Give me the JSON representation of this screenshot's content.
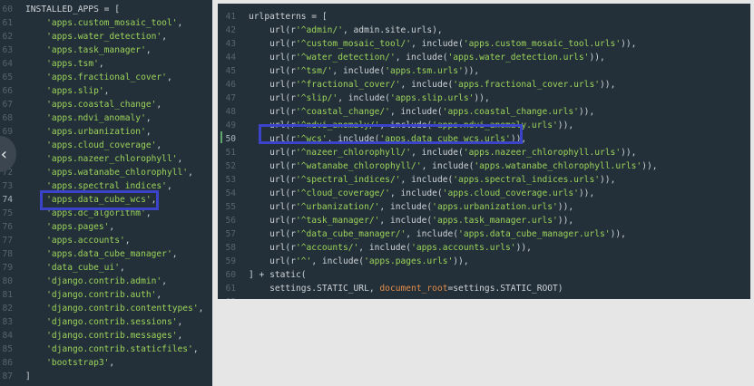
{
  "left_editor": {
    "lines": [
      {
        "n": "60",
        "parts": [
          [
            "src",
            "INSTALLED_APPS = ["
          ]
        ]
      },
      {
        "n": "61",
        "parts": [
          [
            "src",
            "    "
          ],
          [
            "str",
            "'apps.custom_mosaic_tool'"
          ],
          [
            "src",
            ","
          ]
        ]
      },
      {
        "n": "62",
        "parts": [
          [
            "src",
            "    "
          ],
          [
            "str",
            "'apps.water_detection'"
          ],
          [
            "src",
            ","
          ]
        ]
      },
      {
        "n": "63",
        "parts": [
          [
            "src",
            "    "
          ],
          [
            "str",
            "'apps.task_manager'"
          ],
          [
            "src",
            ","
          ]
        ]
      },
      {
        "n": "64",
        "parts": [
          [
            "src",
            "    "
          ],
          [
            "str",
            "'apps.tsm'"
          ],
          [
            "src",
            ","
          ]
        ]
      },
      {
        "n": "65",
        "parts": [
          [
            "src",
            "    "
          ],
          [
            "str",
            "'apps.fractional_cover'"
          ],
          [
            "src",
            ","
          ]
        ]
      },
      {
        "n": "66",
        "parts": [
          [
            "src",
            "    "
          ],
          [
            "str",
            "'apps.slip'"
          ],
          [
            "src",
            ","
          ]
        ]
      },
      {
        "n": "67",
        "parts": [
          [
            "src",
            "    "
          ],
          [
            "str",
            "'apps.coastal_change'"
          ],
          [
            "src",
            ","
          ]
        ]
      },
      {
        "n": "68",
        "parts": [
          [
            "src",
            "    "
          ],
          [
            "str",
            "'apps.ndvi_anomaly'"
          ],
          [
            "src",
            ","
          ]
        ]
      },
      {
        "n": "69",
        "parts": [
          [
            "src",
            "    "
          ],
          [
            "str",
            "'apps.urbanization'"
          ],
          [
            "src",
            ","
          ]
        ]
      },
      {
        "n": "70",
        "parts": [
          [
            "src",
            "    "
          ],
          [
            "str",
            "'apps.cloud_coverage'"
          ],
          [
            "src",
            ","
          ]
        ]
      },
      {
        "n": "71",
        "parts": [
          [
            "src",
            "    "
          ],
          [
            "str",
            "'apps.nazeer_chlorophyll'"
          ],
          [
            "src",
            ","
          ]
        ]
      },
      {
        "n": "72",
        "parts": [
          [
            "src",
            "    "
          ],
          [
            "str",
            "'apps.watanabe_chlorophyll'"
          ],
          [
            "src",
            ","
          ]
        ]
      },
      {
        "n": "73",
        "parts": [
          [
            "src",
            "    "
          ],
          [
            "str",
            "'apps.spectral_indices'"
          ],
          [
            "src",
            ","
          ]
        ]
      },
      {
        "n": "74",
        "parts": [
          [
            "src",
            "    "
          ],
          [
            "str",
            "'apps.data_cube_wcs'"
          ],
          [
            "src",
            ","
          ]
        ],
        "active": true
      },
      {
        "n": "75",
        "parts": [
          [
            "src",
            "    "
          ],
          [
            "str",
            "'apps.dc_algorithm'"
          ],
          [
            "src",
            ","
          ]
        ]
      },
      {
        "n": "76",
        "parts": [
          [
            "src",
            "    "
          ],
          [
            "str",
            "'apps.pages'"
          ],
          [
            "src",
            ","
          ]
        ]
      },
      {
        "n": "77",
        "parts": [
          [
            "src",
            "    "
          ],
          [
            "str",
            "'apps.accounts'"
          ],
          [
            "src",
            ","
          ]
        ]
      },
      {
        "n": "78",
        "parts": [
          [
            "src",
            "    "
          ],
          [
            "str",
            "'apps.data_cube_manager'"
          ],
          [
            "src",
            ","
          ]
        ]
      },
      {
        "n": "79",
        "parts": [
          [
            "src",
            "    "
          ],
          [
            "str",
            "'data_cube_ui'"
          ],
          [
            "src",
            ","
          ]
        ]
      },
      {
        "n": "80",
        "parts": [
          [
            "src",
            "    "
          ],
          [
            "str",
            "'django.contrib.admin'"
          ],
          [
            "src",
            ","
          ]
        ]
      },
      {
        "n": "81",
        "parts": [
          [
            "src",
            "    "
          ],
          [
            "str",
            "'django.contrib.auth'"
          ],
          [
            "src",
            ","
          ]
        ]
      },
      {
        "n": "82",
        "parts": [
          [
            "src",
            "    "
          ],
          [
            "str",
            "'django.contrib.contenttypes'"
          ],
          [
            "src",
            ","
          ]
        ]
      },
      {
        "n": "83",
        "parts": [
          [
            "src",
            "    "
          ],
          [
            "str",
            "'django.contrib.sessions'"
          ],
          [
            "src",
            ","
          ]
        ]
      },
      {
        "n": "84",
        "parts": [
          [
            "src",
            "    "
          ],
          [
            "str",
            "'django.contrib.messages'"
          ],
          [
            "src",
            ","
          ]
        ]
      },
      {
        "n": "85",
        "parts": [
          [
            "src",
            "    "
          ],
          [
            "str",
            "'django.contrib.staticfiles'"
          ],
          [
            "src",
            ","
          ]
        ]
      },
      {
        "n": "86",
        "parts": [
          [
            "src",
            "    "
          ],
          [
            "str",
            "'bootstrap3'"
          ],
          [
            "src",
            ","
          ]
        ]
      },
      {
        "n": "87",
        "parts": [
          [
            "src",
            "]"
          ]
        ]
      }
    ]
  },
  "right_editor": {
    "lines": [
      {
        "n": "41",
        "parts": [
          [
            "src",
            "urlpatterns = ["
          ]
        ]
      },
      {
        "n": "42",
        "parts": [
          [
            "src",
            "    url(r"
          ],
          [
            "str",
            "'^admin/'"
          ],
          [
            "src",
            ", admin.site.urls),"
          ]
        ]
      },
      {
        "n": "43",
        "parts": [
          [
            "src",
            "    url(r"
          ],
          [
            "str",
            "'^custom_mosaic_tool/'"
          ],
          [
            "src",
            ", include("
          ],
          [
            "str",
            "'apps.custom_mosaic_tool.urls'"
          ],
          [
            "src",
            ")),"
          ]
        ]
      },
      {
        "n": "44",
        "parts": [
          [
            "src",
            "    url(r"
          ],
          [
            "str",
            "'^water_detection/'"
          ],
          [
            "src",
            ", include("
          ],
          [
            "str",
            "'apps.water_detection.urls'"
          ],
          [
            "src",
            ")),"
          ]
        ]
      },
      {
        "n": "45",
        "parts": [
          [
            "src",
            "    url(r"
          ],
          [
            "str",
            "'^tsm/'"
          ],
          [
            "src",
            ", include("
          ],
          [
            "str",
            "'apps.tsm.urls'"
          ],
          [
            "src",
            ")),"
          ]
        ]
      },
      {
        "n": "46",
        "parts": [
          [
            "src",
            "    url(r"
          ],
          [
            "str",
            "'^fractional_cover/'"
          ],
          [
            "src",
            ", include("
          ],
          [
            "str",
            "'apps.fractional_cover.urls'"
          ],
          [
            "src",
            ")),"
          ]
        ]
      },
      {
        "n": "47",
        "parts": [
          [
            "src",
            "    url(r"
          ],
          [
            "str",
            "'^slip/'"
          ],
          [
            "src",
            ", include("
          ],
          [
            "str",
            "'apps.slip.urls'"
          ],
          [
            "src",
            ")),"
          ]
        ]
      },
      {
        "n": "48",
        "parts": [
          [
            "src",
            "    url(r"
          ],
          [
            "str",
            "'^coastal_change/'"
          ],
          [
            "src",
            ", include("
          ],
          [
            "str",
            "'apps.coastal_change.urls'"
          ],
          [
            "src",
            ")),"
          ]
        ]
      },
      {
        "n": "49",
        "parts": [
          [
            "src",
            "    url(r"
          ],
          [
            "str",
            "'^ndvi_anomaly/'"
          ],
          [
            "src",
            ", include("
          ],
          [
            "str",
            "'apps.ndvi_anomaly.urls'"
          ],
          [
            "src",
            ")),"
          ]
        ]
      },
      {
        "n": "50",
        "parts": [
          [
            "src",
            "    url(r"
          ],
          [
            "str",
            "'^wcs'"
          ],
          [
            "src",
            ", include("
          ],
          [
            "str",
            "'apps.data_cube_wcs.urls'"
          ],
          [
            "src",
            ")),"
          ]
        ],
        "active": true
      },
      {
        "n": "51",
        "parts": [
          [
            "src",
            "    url(r"
          ],
          [
            "str",
            "'^nazeer_chlorophyll/'"
          ],
          [
            "src",
            ", include("
          ],
          [
            "str",
            "'apps.nazeer_chlorophyll.urls'"
          ],
          [
            "src",
            ")),"
          ]
        ]
      },
      {
        "n": "52",
        "parts": [
          [
            "src",
            "    url(r"
          ],
          [
            "str",
            "'^watanabe_chlorophyll/'"
          ],
          [
            "src",
            ", include("
          ],
          [
            "str",
            "'apps.watanabe_chlorophyll.urls'"
          ],
          [
            "src",
            ")),"
          ]
        ]
      },
      {
        "n": "53",
        "parts": [
          [
            "src",
            "    url(r"
          ],
          [
            "str",
            "'^spectral_indices/'"
          ],
          [
            "src",
            ", include("
          ],
          [
            "str",
            "'apps.spectral_indices.urls'"
          ],
          [
            "src",
            ")),"
          ]
        ]
      },
      {
        "n": "54",
        "parts": [
          [
            "src",
            "    url(r"
          ],
          [
            "str",
            "'^cloud_coverage/'"
          ],
          [
            "src",
            ", include("
          ],
          [
            "str",
            "'apps.cloud_coverage.urls'"
          ],
          [
            "src",
            ")),"
          ]
        ]
      },
      {
        "n": "55",
        "parts": [
          [
            "src",
            "    url(r"
          ],
          [
            "str",
            "'^urbanization/'"
          ],
          [
            "src",
            ", include("
          ],
          [
            "str",
            "'apps.urbanization.urls'"
          ],
          [
            "src",
            ")),"
          ]
        ]
      },
      {
        "n": "56",
        "parts": [
          [
            "src",
            "    url(r"
          ],
          [
            "str",
            "'^task_manager/'"
          ],
          [
            "src",
            ", include("
          ],
          [
            "str",
            "'apps.task_manager.urls'"
          ],
          [
            "src",
            ")),"
          ]
        ]
      },
      {
        "n": "57",
        "parts": [
          [
            "src",
            "    url(r"
          ],
          [
            "str",
            "'^data_cube_manager/'"
          ],
          [
            "src",
            ", include("
          ],
          [
            "str",
            "'apps.data_cube_manager.urls'"
          ],
          [
            "src",
            ")),"
          ]
        ]
      },
      {
        "n": "58",
        "parts": [
          [
            "src",
            "    url(r"
          ],
          [
            "str",
            "'^accounts/'"
          ],
          [
            "src",
            ", include("
          ],
          [
            "str",
            "'apps.accounts.urls'"
          ],
          [
            "src",
            ")),"
          ]
        ]
      },
      {
        "n": "59",
        "parts": [
          [
            "src",
            "    url(r"
          ],
          [
            "str",
            "'^'"
          ],
          [
            "src",
            ", include("
          ],
          [
            "str",
            "'apps.pages.urls'"
          ],
          [
            "src",
            ")),"
          ]
        ]
      },
      {
        "n": "60",
        "parts": [
          [
            "src",
            "] + static("
          ]
        ]
      },
      {
        "n": "61",
        "parts": [
          [
            "src",
            "    settings.STATIC_URL, "
          ],
          [
            "param",
            "document_root"
          ],
          [
            "src",
            "=settings.STATIC_ROOT)"
          ]
        ]
      },
      {
        "n": "62",
        "parts": [
          [
            "src",
            ""
          ]
        ]
      }
    ]
  },
  "nav": {
    "prev_icon_glyph": "‹"
  },
  "colors": {
    "editor_bg": "#243039",
    "string": "#9bd35a",
    "text": "#cdd3d8",
    "line_number": "#56646e",
    "highlight_box": "#3b44c9",
    "param": "#e08c4a"
  }
}
